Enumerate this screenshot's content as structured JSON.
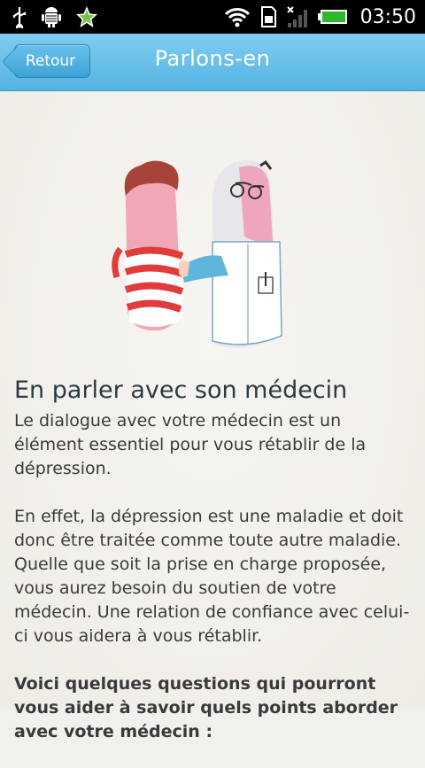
{
  "status_bar": {
    "time": "03:50",
    "icons": [
      "usb-icon",
      "android-debug-icon",
      "star-icon",
      "wifi-icon",
      "sd-card-icon",
      "signal-icon",
      "battery-icon"
    ]
  },
  "header": {
    "back_label": "Retour",
    "title": "Parlons-en"
  },
  "article": {
    "title": "En parler avec son médecin",
    "paragraphs": [
      "Le dialogue avec votre médecin est un élément essentiel pour vous rétablir de la dépression.",
      "En effet, la dépression est une maladie et doit donc être traitée comme toute autre maladie. Quelle que soit la prise en charge proposée, vous aurez besoin du soutien de votre médecin. Une relation de confiance avec celui-ci vous aidera à vous rétablir."
    ],
    "bold_intro": "Voici quelques questions qui pourront vous aider à savoir quels points aborder avec votre médecin :"
  },
  "colors": {
    "header_blue": "#55b3e3",
    "text": "#3a3a3a",
    "title": "#2c3a44"
  }
}
